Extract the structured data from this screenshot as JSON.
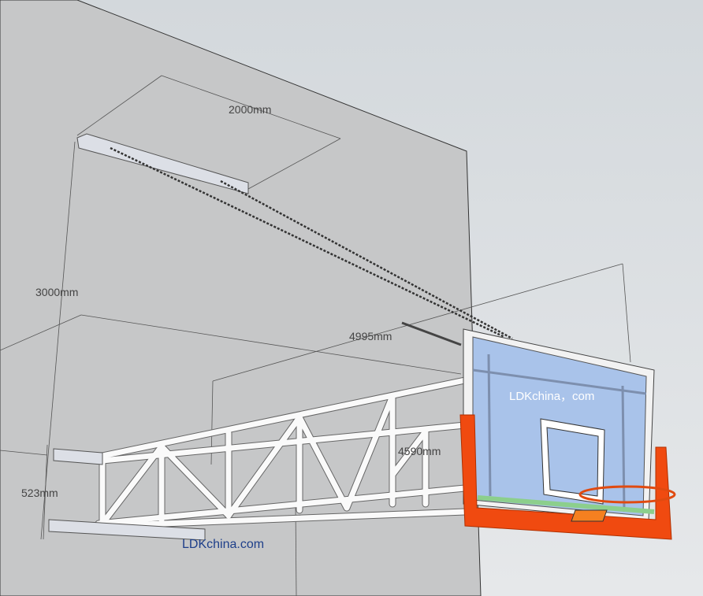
{
  "dimensions": {
    "bracket_width": "2000mm",
    "mount_height": "3000mm",
    "total_extension": "4995mm",
    "arm_length": "4590mm",
    "arm_spacing": "523mm"
  },
  "watermarks": {
    "wall": "LDKchina.com",
    "backboard": "LDKchina，com"
  },
  "colors": {
    "wall": "#c6c7c8",
    "background": "#dde1e4",
    "backboard_glass": "#a9c3ea",
    "padding": "#f04a10",
    "target_square": "#ffffff",
    "watermark_wall": "#1e3f8a"
  }
}
